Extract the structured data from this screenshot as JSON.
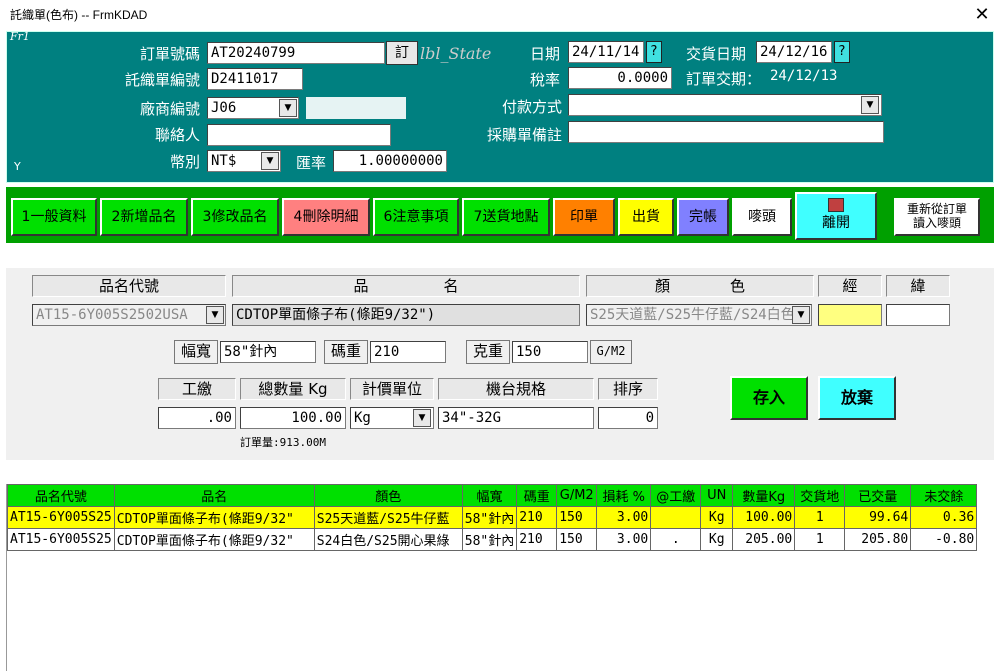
{
  "window": {
    "title": "託織單(色布) -- FrmKDAD",
    "close_glyph": "✕"
  },
  "frame_label": "Fr1",
  "frame_y_label": "Y",
  "header": {
    "order_no_label": "訂單號碼",
    "order_no_value": "AT20240799",
    "order_btn_label": "訂",
    "lbl_state": "lbl_State",
    "weave_no_label": "託織單編號",
    "weave_no_value": "D2411017",
    "vendor_no_label": "廠商編號",
    "vendor_no_value": "J06",
    "contact_label": "聯絡人",
    "contact_value": "",
    "currency_label": "幣別",
    "currency_value": "NT$",
    "rate_label": "匯率",
    "rate_value": "1.00000000",
    "date_label": "日期",
    "date_value": "24/11/14",
    "delivery_date_label": "交貨日期",
    "delivery_date_value": "24/12/16",
    "q_glyph": "?",
    "tax_rate_label": "稅率",
    "tax_rate_value": "0.0000",
    "order_delivery_label": "訂單交期：",
    "order_delivery_value": "24/12/13",
    "payment_label": "付款方式",
    "payment_value": "",
    "purchase_note_label": "採購單備註",
    "purchase_note_value": ""
  },
  "toolbar": {
    "general": "1一般資料",
    "add_item": "2新增品名",
    "edit_item": "3修改品名",
    "delete_detail": "4刪除明細",
    "notes": "6注意事項",
    "delivery_place": "7送貨地點",
    "print": "印單",
    "ship": "出貨",
    "close_account": "完帳",
    "mark": "嘜頭",
    "exit": "離開",
    "reload_mark_line1": "重新從訂單",
    "reload_mark_line2": "讀入嘜頭",
    "colors": {
      "green": "#00e000",
      "pink": "#ff8080",
      "orange": "#ff8000",
      "yellow": "#ffff00",
      "violet": "#8080ff",
      "white": "#ffffff",
      "cyan": "#40ffff"
    }
  },
  "detail": {
    "item_code_label": "品名代號",
    "item_name_label": "品　　　　　名",
    "color_label": "顏　　　　色",
    "warp_label": "經",
    "weft_label": "緯",
    "item_code_value": "AT15-6Y005S2502USA",
    "item_name_value": "CDTOP單面條子布(條距9/32\")",
    "color_value": "S25天道藍/S25牛仔藍/S24白色",
    "warp_value": "",
    "weft_value": "",
    "width_label": "幅寬",
    "width_value": "58\"針內",
    "code_weight_label": "碼重",
    "code_weight_value": "210",
    "gram_weight_label": "克重",
    "gram_weight_value": "150",
    "gram_unit": "G/M2",
    "wage_label": "工繳",
    "wage_value": ".00",
    "total_qty_label": "總數量 Kg",
    "total_qty_value": "100.00",
    "pricing_unit_label": "計價單位",
    "pricing_unit_value": "Kg",
    "machine_spec_label": "機台規格",
    "machine_spec_value": "34\"-32G",
    "sort_label": "排序",
    "sort_value": "0",
    "order_qty_text": "訂單量:913.00M",
    "save_label": "存入",
    "cancel_label": "放棄"
  },
  "grid": {
    "headers": [
      "品名代號",
      "品名",
      "顏色",
      "幅寬",
      "碼重",
      "G/M2",
      "損耗 %",
      "@工繳",
      "UN",
      "數量Kg",
      "交貨地",
      "已交量",
      "未交餘"
    ],
    "rows": [
      [
        "AT15-6Y005S25",
        "CDTOP單面條子布(條距9/32\"",
        "S25天道藍/S25牛仔藍",
        "58\"針內",
        "210",
        "150",
        "3.00",
        "",
        "Kg",
        "100.00",
        "1",
        "99.64",
        "0.36"
      ],
      [
        "AT15-6Y005S25",
        "CDTOP單面條子布(條距9/32\"",
        "S24白色/S25開心果綠",
        "58\"針內",
        "210",
        "150",
        "3.00",
        ".",
        "Kg",
        "205.00",
        "1",
        "205.80",
        "-0.80"
      ]
    ]
  }
}
